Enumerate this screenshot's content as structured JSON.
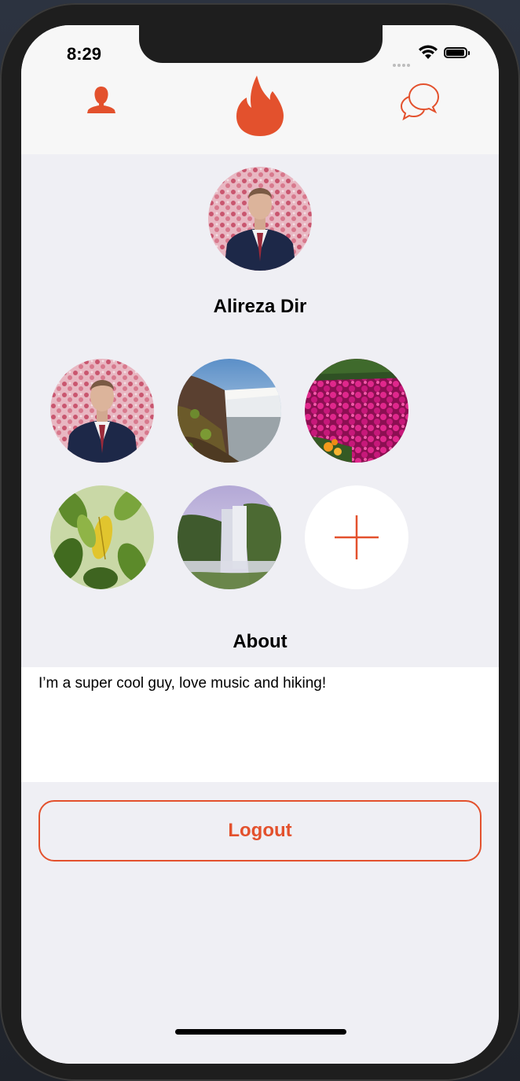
{
  "status_bar": {
    "time": "8:29"
  },
  "nav": {
    "left_icon": "profile-icon",
    "center_icon": "flame-icon",
    "right_icon": "chat-bubbles-icon",
    "accent_color": "#e3512d"
  },
  "profile": {
    "name": "Alireza Dir",
    "photos": [
      "portrait",
      "waterfall-cliffs",
      "pink-flowers",
      "leaves",
      "waterfall-mist"
    ],
    "add_photo_icon": "plus-icon"
  },
  "about": {
    "heading": "About",
    "text": "I’m a super cool guy, love music and hiking!"
  },
  "actions": {
    "logout_label": "Logout"
  }
}
